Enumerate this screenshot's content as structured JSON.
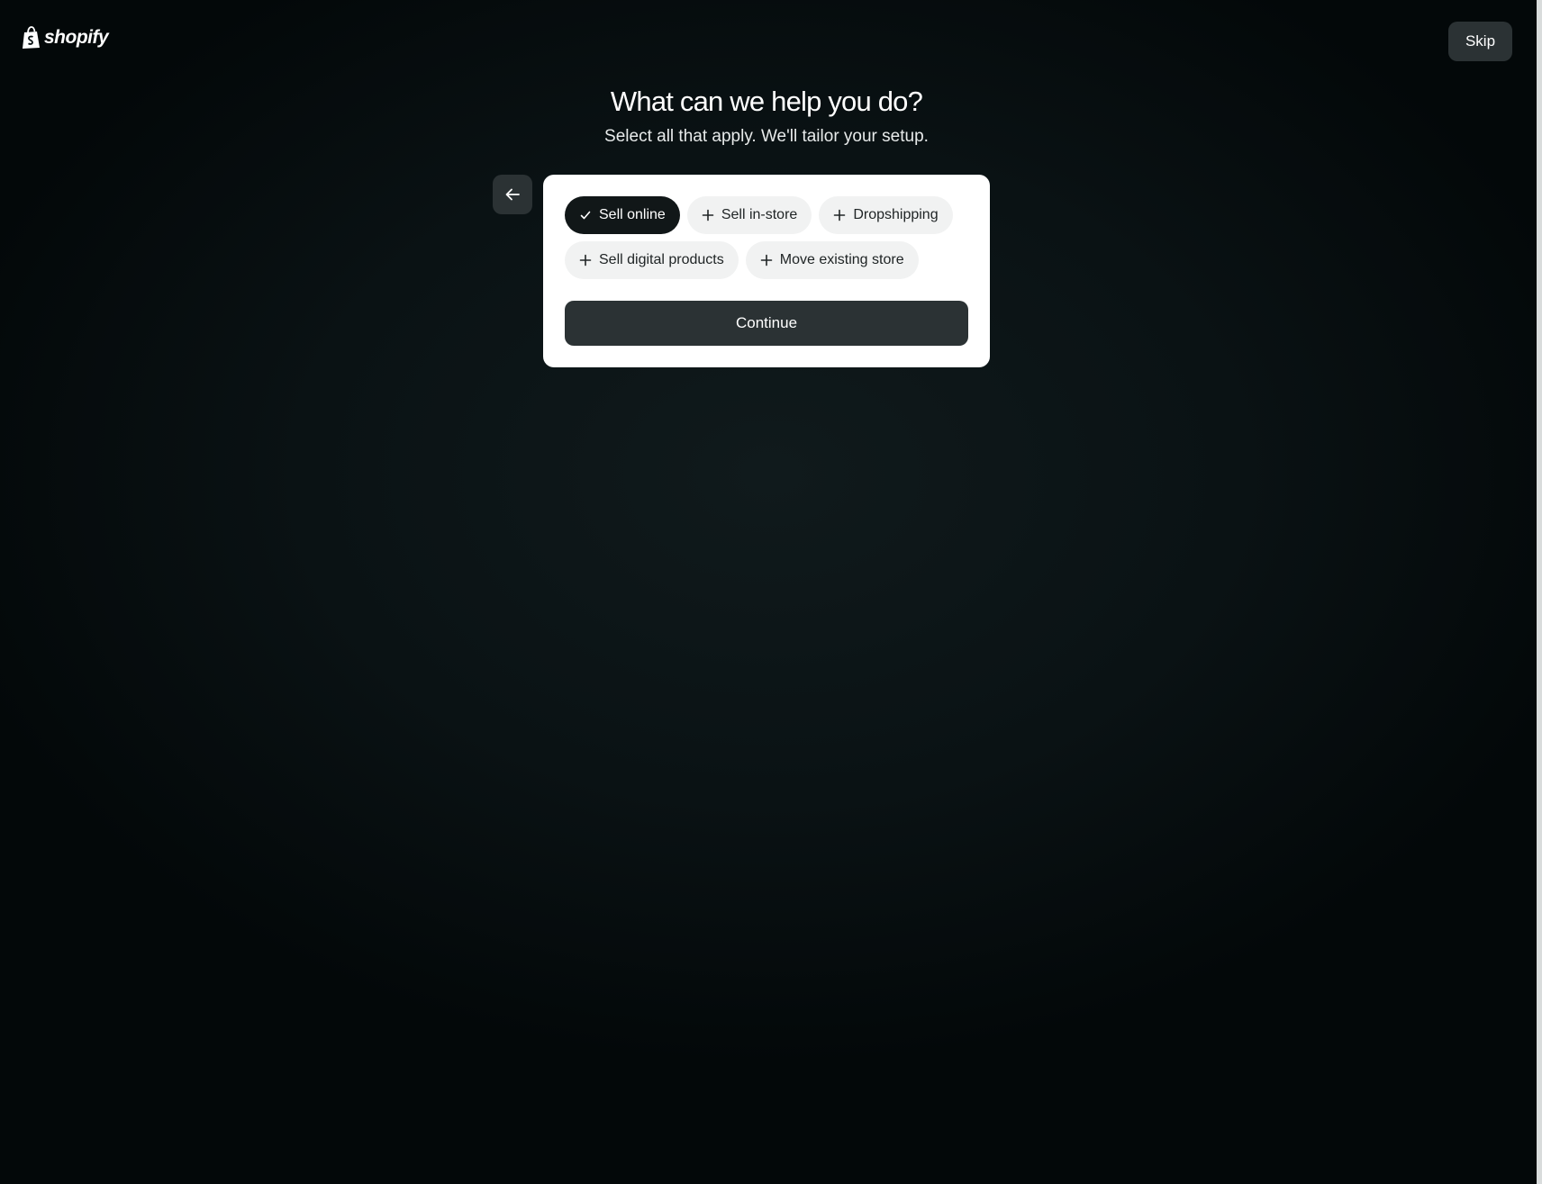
{
  "header": {
    "logo_text": "shopify",
    "skip_label": "Skip"
  },
  "main": {
    "title": "What can we help you do?",
    "subtitle": "Select all that apply. We'll tailor your setup.",
    "back_icon": "arrow-left-icon",
    "options": [
      {
        "label": "Sell online",
        "selected": true,
        "icon": "check-icon"
      },
      {
        "label": "Sell in-store",
        "selected": false,
        "icon": "plus-icon"
      },
      {
        "label": "Dropshipping",
        "selected": false,
        "icon": "plus-icon"
      },
      {
        "label": "Sell digital products",
        "selected": false,
        "icon": "plus-icon"
      },
      {
        "label": "Move existing store",
        "selected": false,
        "icon": "plus-icon"
      }
    ],
    "continue_label": "Continue"
  },
  "colors": {
    "background": "#0a1214",
    "card": "#ffffff",
    "button_dark": "#2b3234",
    "chip_selected": "#111718",
    "chip_default": "#f1f2f2"
  }
}
